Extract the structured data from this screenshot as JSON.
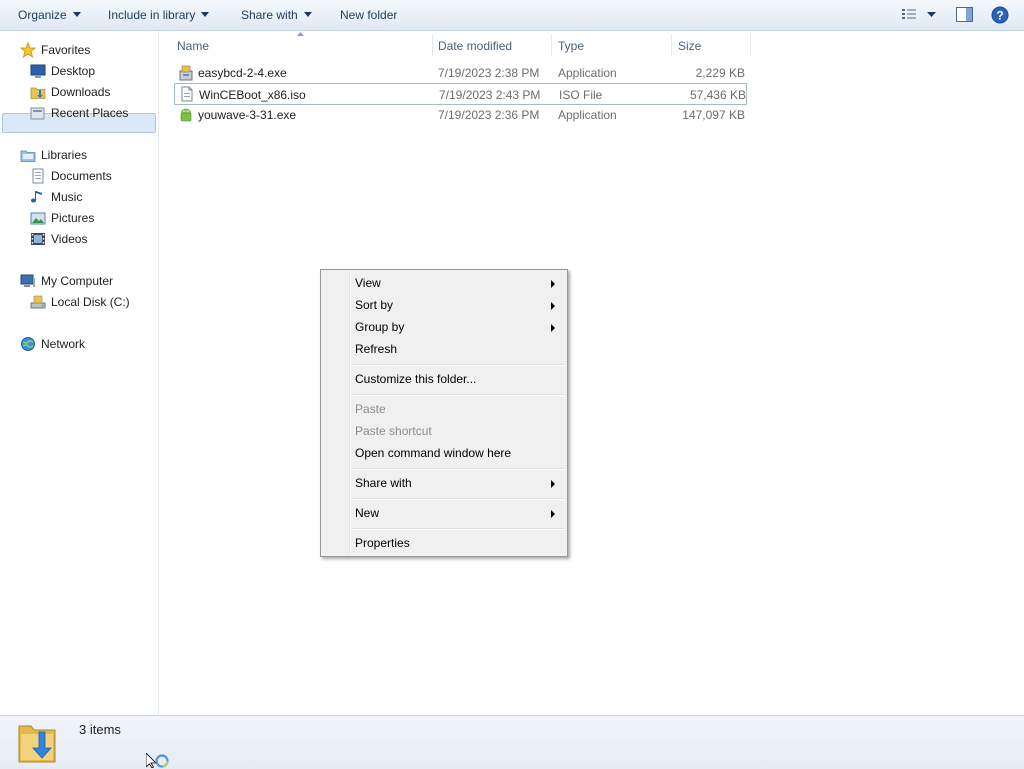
{
  "toolbar": {
    "organize": "Organize",
    "include_in_library": "Include in library",
    "share_with": "Share with",
    "new_folder": "New folder",
    "icons": [
      "view-options-icon",
      "view-dropdown-icon",
      "preview-pane-icon",
      "help-icon"
    ]
  },
  "nav": {
    "favorites": {
      "label": "Favorites",
      "icon": "star-icon"
    },
    "favorites_items": [
      {
        "label": "Desktop",
        "icon": "desktop-icon"
      },
      {
        "label": "Downloads",
        "icon": "downloads-folder-icon",
        "selected": true
      },
      {
        "label": "Recent Places",
        "icon": "recent-places-icon"
      }
    ],
    "libraries": {
      "label": "Libraries",
      "icon": "libraries-icon"
    },
    "libraries_items": [
      {
        "label": "Documents",
        "icon": "documents-icon"
      },
      {
        "label": "Music",
        "icon": "music-icon"
      },
      {
        "label": "Pictures",
        "icon": "pictures-icon"
      },
      {
        "label": "Videos",
        "icon": "videos-icon"
      }
    ],
    "computer": {
      "label": "My Computer",
      "icon": "computer-icon"
    },
    "computer_items": [
      {
        "label": "Local Disk (C:)",
        "icon": "drive-icon"
      }
    ],
    "network": {
      "label": "Network",
      "icon": "network-icon"
    }
  },
  "columns": {
    "name": "Name",
    "date_modified": "Date modified",
    "type": "Type",
    "size": "Size"
  },
  "files": [
    {
      "name": "easybcd-2-4.exe",
      "date": "7/19/2023 2:38 PM",
      "type": "Application",
      "size": "2,229 KB",
      "icon": "installer-icon"
    },
    {
      "name": "WinCEBoot_x86.iso",
      "date": "7/19/2023 2:43 PM",
      "type": "ISO File",
      "size": "57,436 KB",
      "icon": "iso-file-icon",
      "selected": true
    },
    {
      "name": "youwave-3-31.exe",
      "date": "7/19/2023 2:36 PM",
      "type": "Application",
      "size": "147,097 KB",
      "icon": "android-app-icon"
    }
  ],
  "context_menu": {
    "view": "View",
    "sort_by": "Sort by",
    "group_by": "Group by",
    "refresh": "Refresh",
    "customize": "Customize this folder...",
    "paste": "Paste",
    "paste_shortcut": "Paste shortcut",
    "open_cmd": "Open command window here",
    "share_with": "Share with",
    "new": "New",
    "properties": "Properties"
  },
  "details": {
    "item_count": "3 items",
    "icon": "downloads-folder-large-icon"
  },
  "colors": {
    "toolbar_text": "#1e3a5f",
    "selection_fill": "#dbe8f7",
    "selection_border": "#a9c6e8",
    "menu_bg": "#f0f0f0",
    "disabled_text": "#8d8d8d"
  }
}
